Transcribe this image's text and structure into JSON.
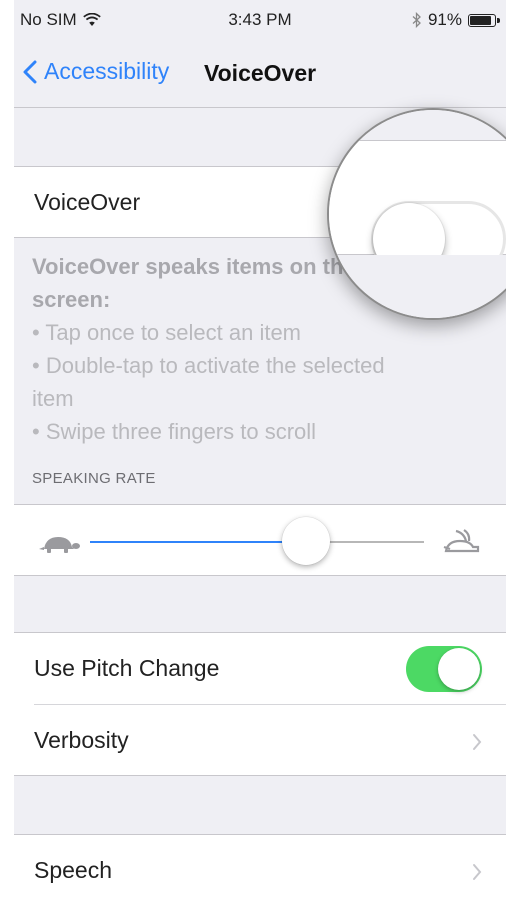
{
  "status_bar": {
    "carrier": "No SIM",
    "time": "3:43 PM",
    "battery": "91%",
    "battery_level": 0.91,
    "wifi_icon": "wifi-icon",
    "bluetooth_icon": "bluetooth-icon"
  },
  "nav": {
    "back_label": "Accessibility",
    "title": "VoiceOver"
  },
  "voiceover": {
    "label": "VoiceOver",
    "enabled": false
  },
  "description": {
    "lead": "VoiceOver speaks items on the screen:",
    "lead_line1": "VoiceOver speaks items on the",
    "lead_line2": "screen:",
    "items": [
      "• Tap once to select an item",
      "• Double-tap to activate the selected",
      "item",
      "• Swipe three fingers to scroll"
    ]
  },
  "speaking_rate": {
    "header": "SPEAKING RATE",
    "value": 0.55,
    "min_icon": "turtle-icon",
    "max_icon": "hare-icon"
  },
  "pitch_change": {
    "label": "Use Pitch Change",
    "enabled": true
  },
  "verbosity": {
    "label": "Verbosity"
  },
  "speech": {
    "label": "Speech"
  },
  "colors": {
    "accent": "#2f83fa",
    "switch_on": "#4cd964",
    "background": "#efeff4"
  }
}
